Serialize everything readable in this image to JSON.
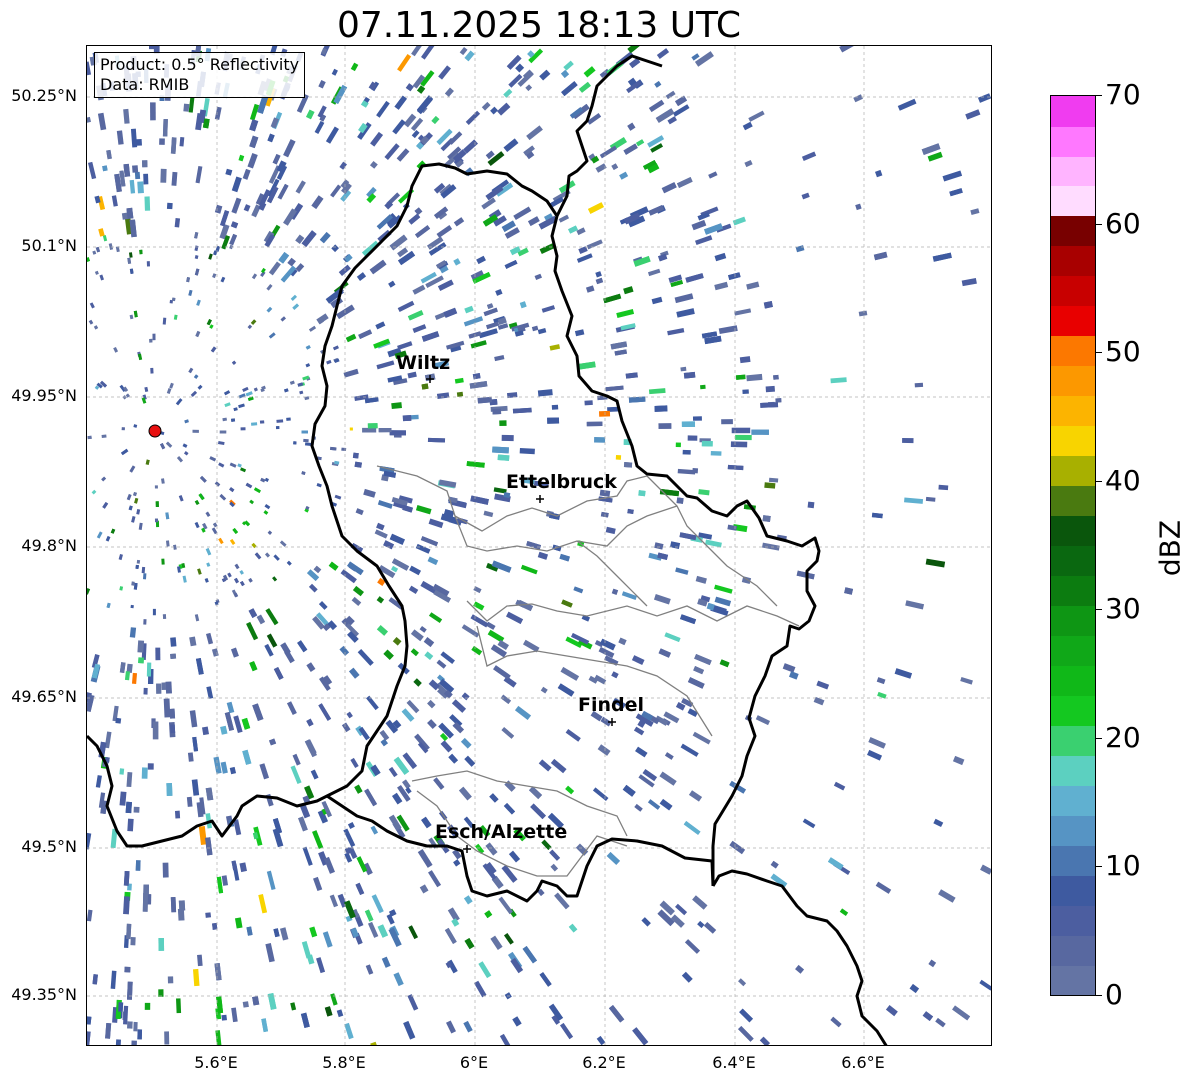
{
  "title": "07.11.2025 18:13 UTC",
  "info": {
    "product": "Product: 0.5° Reflectivity",
    "source": "Data: RMIB"
  },
  "axes": {
    "lat_ticks": [
      "50.25°N",
      "50.1°N",
      "49.95°N",
      "49.8°N",
      "49.65°N",
      "49.5°N",
      "49.35°N"
    ],
    "lon_ticks": [
      "5.6°E",
      "5.8°E",
      "6°E",
      "6.2°E",
      "6.4°E",
      "6.6°E"
    ]
  },
  "cities": [
    {
      "name": "Wiltz"
    },
    {
      "name": "Ettelbruck"
    },
    {
      "name": "Findel"
    },
    {
      "name": "Esch/Alzette"
    }
  ],
  "colorbar": {
    "label": "dBZ",
    "min": 0,
    "max": 70,
    "ticks": [
      "0",
      "10",
      "20",
      "30",
      "40",
      "50",
      "60",
      "70"
    ],
    "colors": [
      "#6474a4",
      "#5868a0",
      "#4c5ea0",
      "#3e5aa0",
      "#4a76b0",
      "#5694c4",
      "#60b0d0",
      "#5cd0c0",
      "#3ad070",
      "#14c820",
      "#10b818",
      "#10a818",
      "#0e9614",
      "#0c7c10",
      "#0a6810",
      "#0a560c",
      "#4a7a10",
      "#a8b000",
      "#f8d400",
      "#fcb400",
      "#fc9800",
      "#fc7800",
      "#e80000",
      "#c80000",
      "#a80000",
      "#780000",
      "#ffdcff",
      "#ffb4ff",
      "#ff78ff",
      "#f03cf0"
    ]
  },
  "radar_site": {
    "color": "#e81010"
  }
}
